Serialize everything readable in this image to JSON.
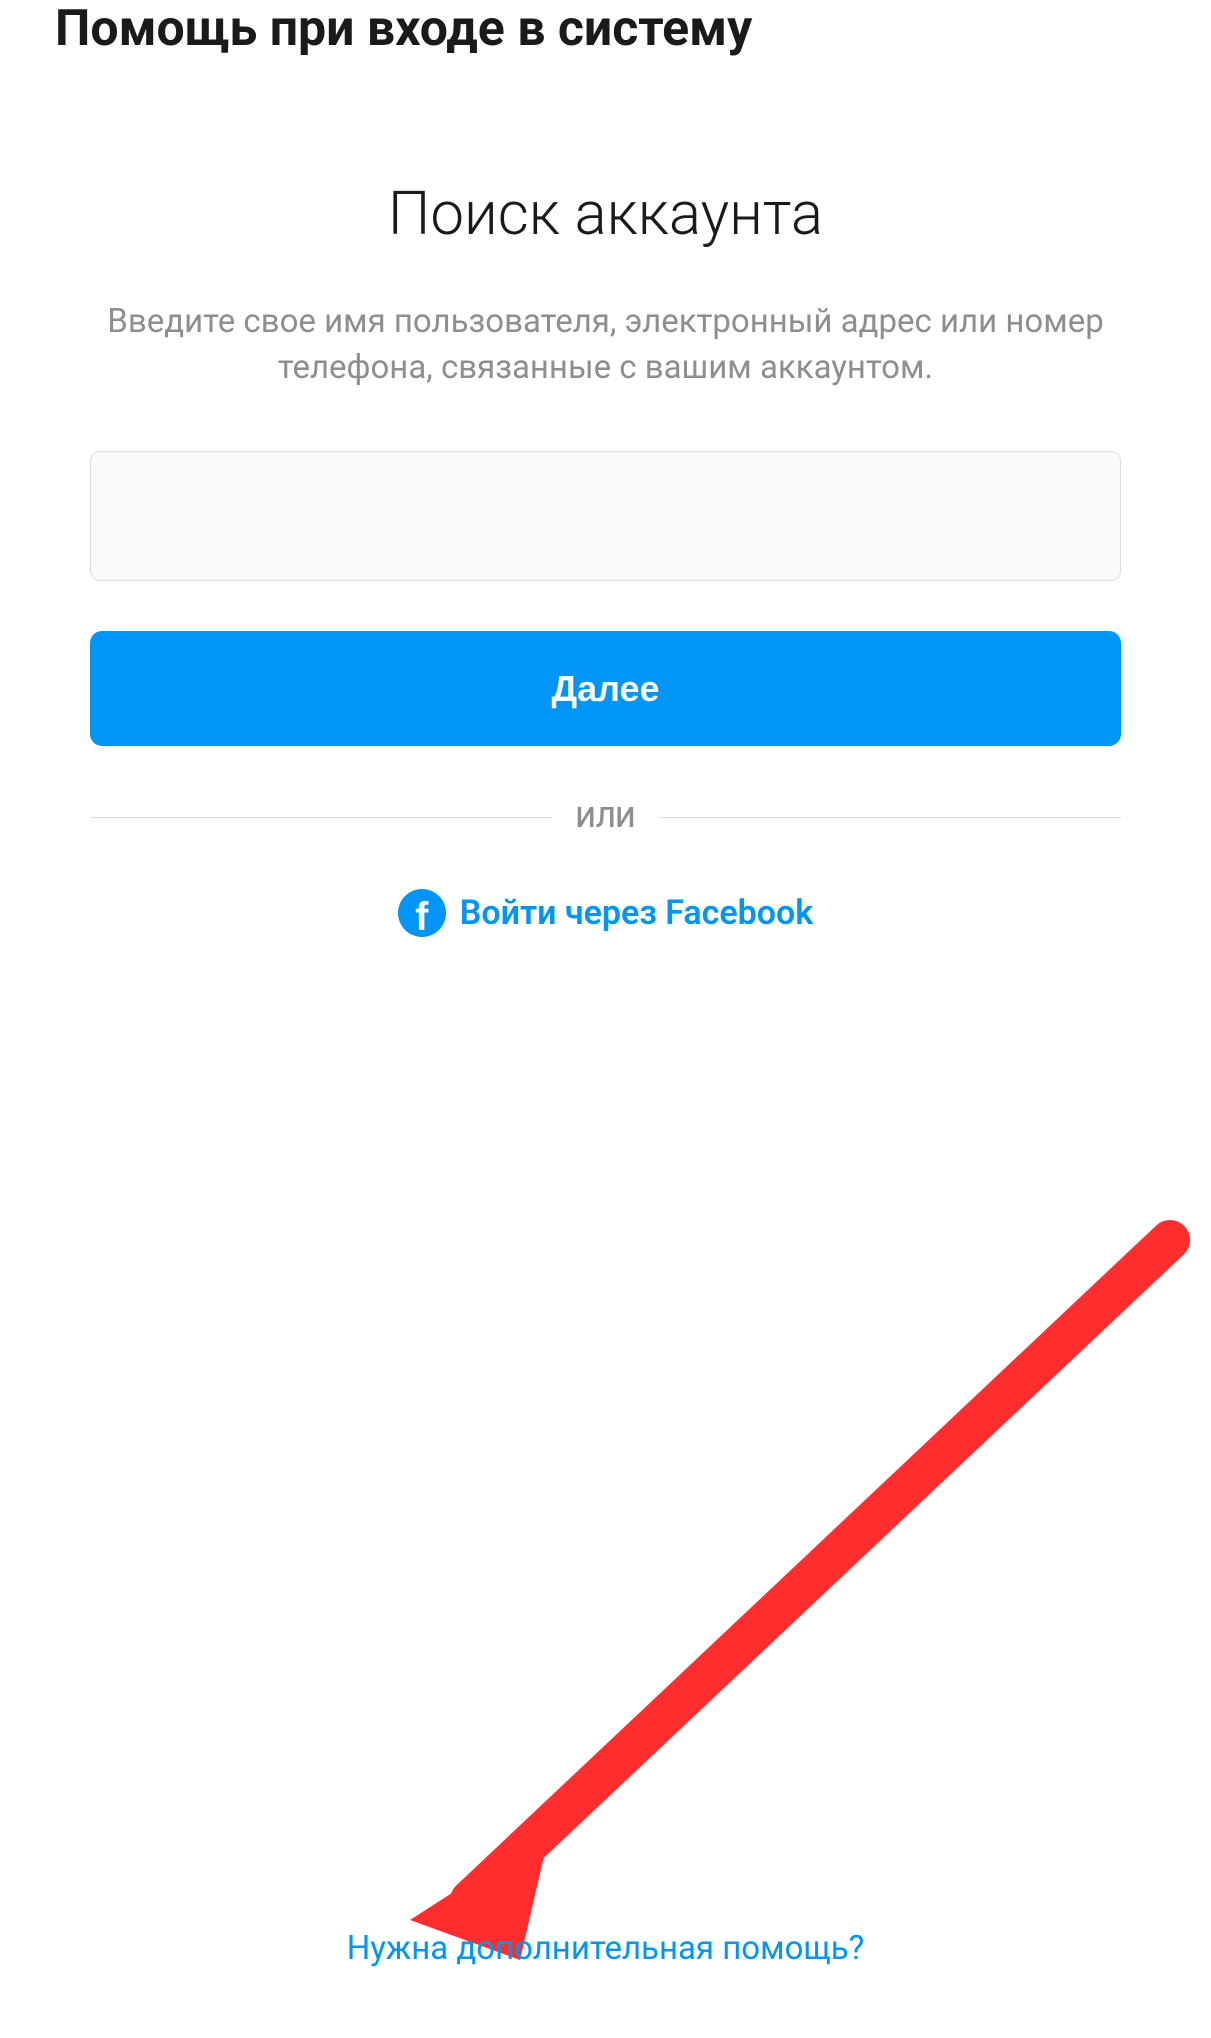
{
  "header": {
    "title": "Помощь при входе в систему"
  },
  "main": {
    "title": "Поиск аккаунта",
    "description": "Введите свое имя пользователя, электронный адрес или номер телефона, связанные с вашим аккаунтом.",
    "input_value": "",
    "next_button_label": "Далее",
    "divider_text": "ИЛИ",
    "facebook_login_label": "Войти через Facebook"
  },
  "footer": {
    "help_link_label": "Нужна дополнительная помощь?"
  },
  "annotation": {
    "arrow_color": "#ff2d2d"
  }
}
